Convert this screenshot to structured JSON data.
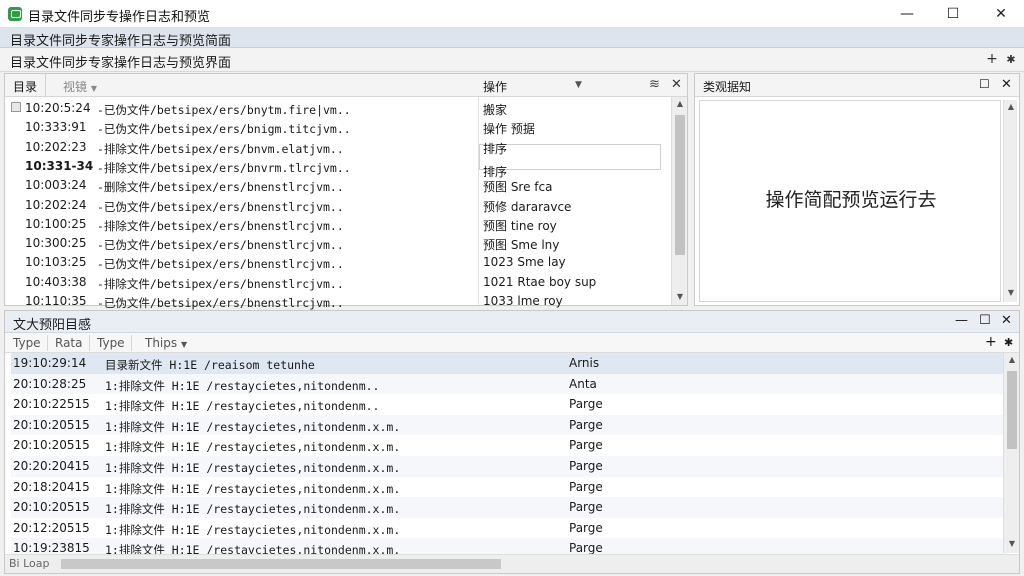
{
  "window": {
    "title": "目录文件同步专操作日志和预览",
    "minimize_glyph": "—",
    "maximize_glyph": "☐",
    "close_glyph": "✕"
  },
  "menu": {
    "label": "目录文件同步专家操作日志与预览简面"
  },
  "panel": {
    "title": "目录文件同步专家操作日志与预览界面",
    "add_glyph": "+",
    "pin_glyph": "✱"
  },
  "log_pane": {
    "tabs": [
      "目录",
      "视镜"
    ],
    "col_action": "操作",
    "filter_glyph": "▼",
    "collapse_glyph": "≋",
    "close_glyph": "✕",
    "rows": [
      {
        "time": "10:20:5:24",
        "path": "-已伪文件/betsipex/ers/bnytm.fire|vm..",
        "action": "搬家",
        "bold": false
      },
      {
        "time": "10:333:91",
        "path": "-已伪文件/betsipex/ers/bnigm.titcjvm..",
        "action": "操作 预据",
        "bold": false
      },
      {
        "time": "10:202:23",
        "path": "-排除文件/betsipex/ers/bnvm.elatjvm..",
        "action": "排序",
        "bold": false
      },
      {
        "time": "10:331-34",
        "path": "-排除文件/betsipex/ers/bnvrm.tlrcjvm..",
        "action": "排序",
        "bold": true
      },
      {
        "time": "10:003:24",
        "path": "-删除文件/betsipex/ers/bnenstlrcjvm..",
        "action": "预图 Sre fca",
        "bold": false
      },
      {
        "time": "10:202:24",
        "path": "-已伪文件/betsipex/ers/bnenstlrcjvm..",
        "action": "预修 dararavce",
        "bold": false
      },
      {
        "time": "10:100:25",
        "path": "-排除文件/betsipex/ers/bnenstlrcjvm..",
        "action": "预图 tine roy",
        "bold": false
      },
      {
        "time": "10:300:25",
        "path": "-已伪文件/betsipex/ers/bnenstlrcjvm..",
        "action": "预图 Sme lny",
        "bold": false
      },
      {
        "time": "10:103:25",
        "path": "-已伪文件/betsipex/ers/bnenstlrcjvm..",
        "action": "1023 Sme lay",
        "bold": false
      },
      {
        "time": "10:403:38",
        "path": "-排除文件/betsipex/ers/bnenstlrcjvm..",
        "action": "1021 Rtae boy sup",
        "bold": false
      },
      {
        "time": "10:110:35",
        "path": "-已伪文件/betsipex/ers/bnenstlrcjvm..",
        "action": "1033 lme roy",
        "bold": false
      }
    ]
  },
  "preview_pane": {
    "title": "类观据知",
    "restore_glyph": "☐",
    "close_glyph": "✕",
    "message": "操作简配预览运行去"
  },
  "bottom_pane": {
    "title": "文大预阳目感",
    "min_glyph": "—",
    "restore_glyph": "☐",
    "close_glyph": "✕",
    "add_glyph": "+",
    "pin_glyph": "✱",
    "columns": [
      "Type",
      "Rata",
      "Type",
      "Thips"
    ],
    "rows": [
      {
        "time": "19:10:29:14",
        "desc": "目录新文件 H:1E /reaisom tetunhe",
        "status": "Arnis"
      },
      {
        "time": "20:10:28:25",
        "desc": "1:排除文件 H:1E /restaycietes,nitondenm..",
        "status": "Anta"
      },
      {
        "time": "20:10:22515",
        "desc": "1:排除文件 H:1E /restaycietes,nitondenm..",
        "status": "Parge"
      },
      {
        "time": "20:10:20515",
        "desc": "1:排除文件 H:1E /restaycietes,nitondenm.x.m.",
        "status": "Parge"
      },
      {
        "time": "20:10:20515",
        "desc": "1:排除文件 H:1E /restaycietes,nitondenm.x.m.",
        "status": "Parge"
      },
      {
        "time": "20:20:20415",
        "desc": "1:排除文件 H:1E /restaycietes,nitondenm.x.m.",
        "status": "Parge"
      },
      {
        "time": "20:18:20415",
        "desc": "1:排除文件 H:1E /restaycietes,nitondenm.x.m.",
        "status": "Parge"
      },
      {
        "time": "20:10:20515",
        "desc": "1:排除文件 H:1E /restaycietes,nitondenm.x.m.",
        "status": "Parge"
      },
      {
        "time": "20:12:20515",
        "desc": "1:排除文件 H:1E /restaycietes,nitondenm.x.m.",
        "status": "Parge"
      },
      {
        "time": "10:19:23815",
        "desc": "1:排除文件 H:1E /restaycietes,nitondenm.x.m.",
        "status": "Parge"
      }
    ],
    "footer": "Bi Loap"
  }
}
